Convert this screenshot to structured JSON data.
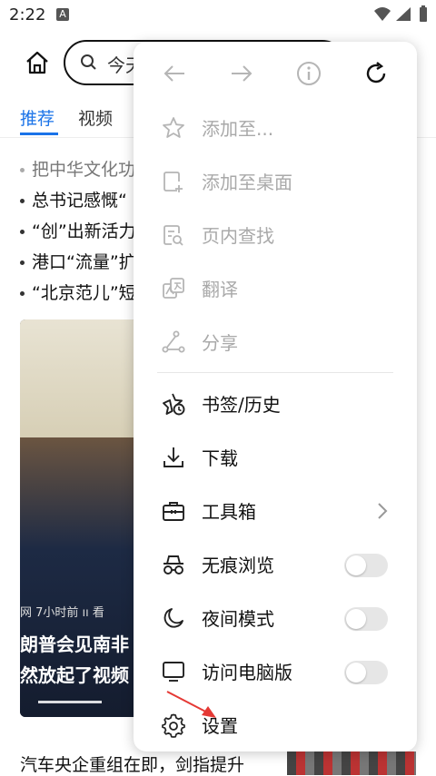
{
  "status": {
    "time": "2:22",
    "badge": "A"
  },
  "search": {
    "query": "今天"
  },
  "tabs": [
    {
      "label": "推荐"
    },
    {
      "label": "视频"
    }
  ],
  "headlines": [
    "把中华文化功",
    "总书记感慨“",
    "“创”出新活力",
    "港口“流量”扩",
    "“北京范儿”短"
  ],
  "feature": {
    "meta": "网 7小时前 ıı 看",
    "caption1": "朗普会见南非",
    "caption2": "然放起了视频"
  },
  "bottom_headline": "汽车央企重组在即，剑指提升",
  "menu": {
    "items": [
      {
        "label": "添加至...",
        "icon": "star-icon",
        "enabled": false
      },
      {
        "label": "添加至桌面",
        "icon": "add-to-desktop-icon",
        "enabled": false
      },
      {
        "label": "页内查找",
        "icon": "find-in-page-icon",
        "enabled": false
      },
      {
        "label": "翻译",
        "icon": "translate-icon",
        "enabled": false
      },
      {
        "label": "分享",
        "icon": "share-icon",
        "enabled": false
      },
      {
        "label": "书签/历史",
        "icon": "bookmark-history-icon",
        "enabled": true
      },
      {
        "label": "下载",
        "icon": "download-icon",
        "enabled": true
      },
      {
        "label": "工具箱",
        "icon": "toolbox-icon",
        "enabled": true,
        "has_submenu": true
      },
      {
        "label": "无痕浏览",
        "icon": "incognito-icon",
        "enabled": true,
        "toggle": false
      },
      {
        "label": "夜间模式",
        "icon": "moon-icon",
        "enabled": true,
        "toggle": false
      },
      {
        "label": "访问电脑版",
        "icon": "desktop-monitor-icon",
        "enabled": true,
        "toggle": false
      },
      {
        "label": "设置",
        "icon": "gear-icon",
        "enabled": true
      }
    ]
  },
  "colors": {
    "accent": "#1a73e8",
    "annotation": "#e53935"
  }
}
